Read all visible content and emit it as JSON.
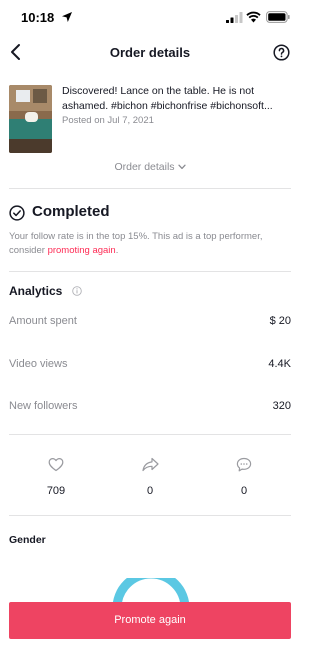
{
  "status_bar": {
    "time": "10:18"
  },
  "nav": {
    "title": "Order details",
    "back_icon": "chevron-left-icon",
    "help_icon": "question-circle-icon"
  },
  "ad": {
    "caption_line1": "Discovered! Lance on the table. He is not",
    "caption_line2": "ashamed. #bichon #bichonfrise #bichonsoft...",
    "posted": "Posted on Jul 7, 2021"
  },
  "details_toggle": {
    "label": "Order details"
  },
  "status": {
    "title": "Completed",
    "description": "Your follow rate is in the top 15%. This ad is a top performer, consider ",
    "link": "promoting again",
    "suffix": "."
  },
  "analytics": {
    "title": "Analytics",
    "metrics": [
      {
        "label": "Amount spent",
        "value": "$ 20"
      },
      {
        "label": "Video views",
        "value": "4.4K"
      },
      {
        "label": "New followers",
        "value": "320"
      }
    ]
  },
  "engagement": [
    {
      "icon": "heart-icon",
      "count": "709"
    },
    {
      "icon": "share-icon",
      "count": "0"
    },
    {
      "icon": "comment-icon",
      "count": "0"
    }
  ],
  "gender": {
    "title": "Gender"
  },
  "cta": {
    "label": "Promote again"
  },
  "colors": {
    "accent": "#ee4462",
    "link": "#fe2c55",
    "muted_text": "#8a8b91",
    "donut": "#5bc8e3"
  }
}
